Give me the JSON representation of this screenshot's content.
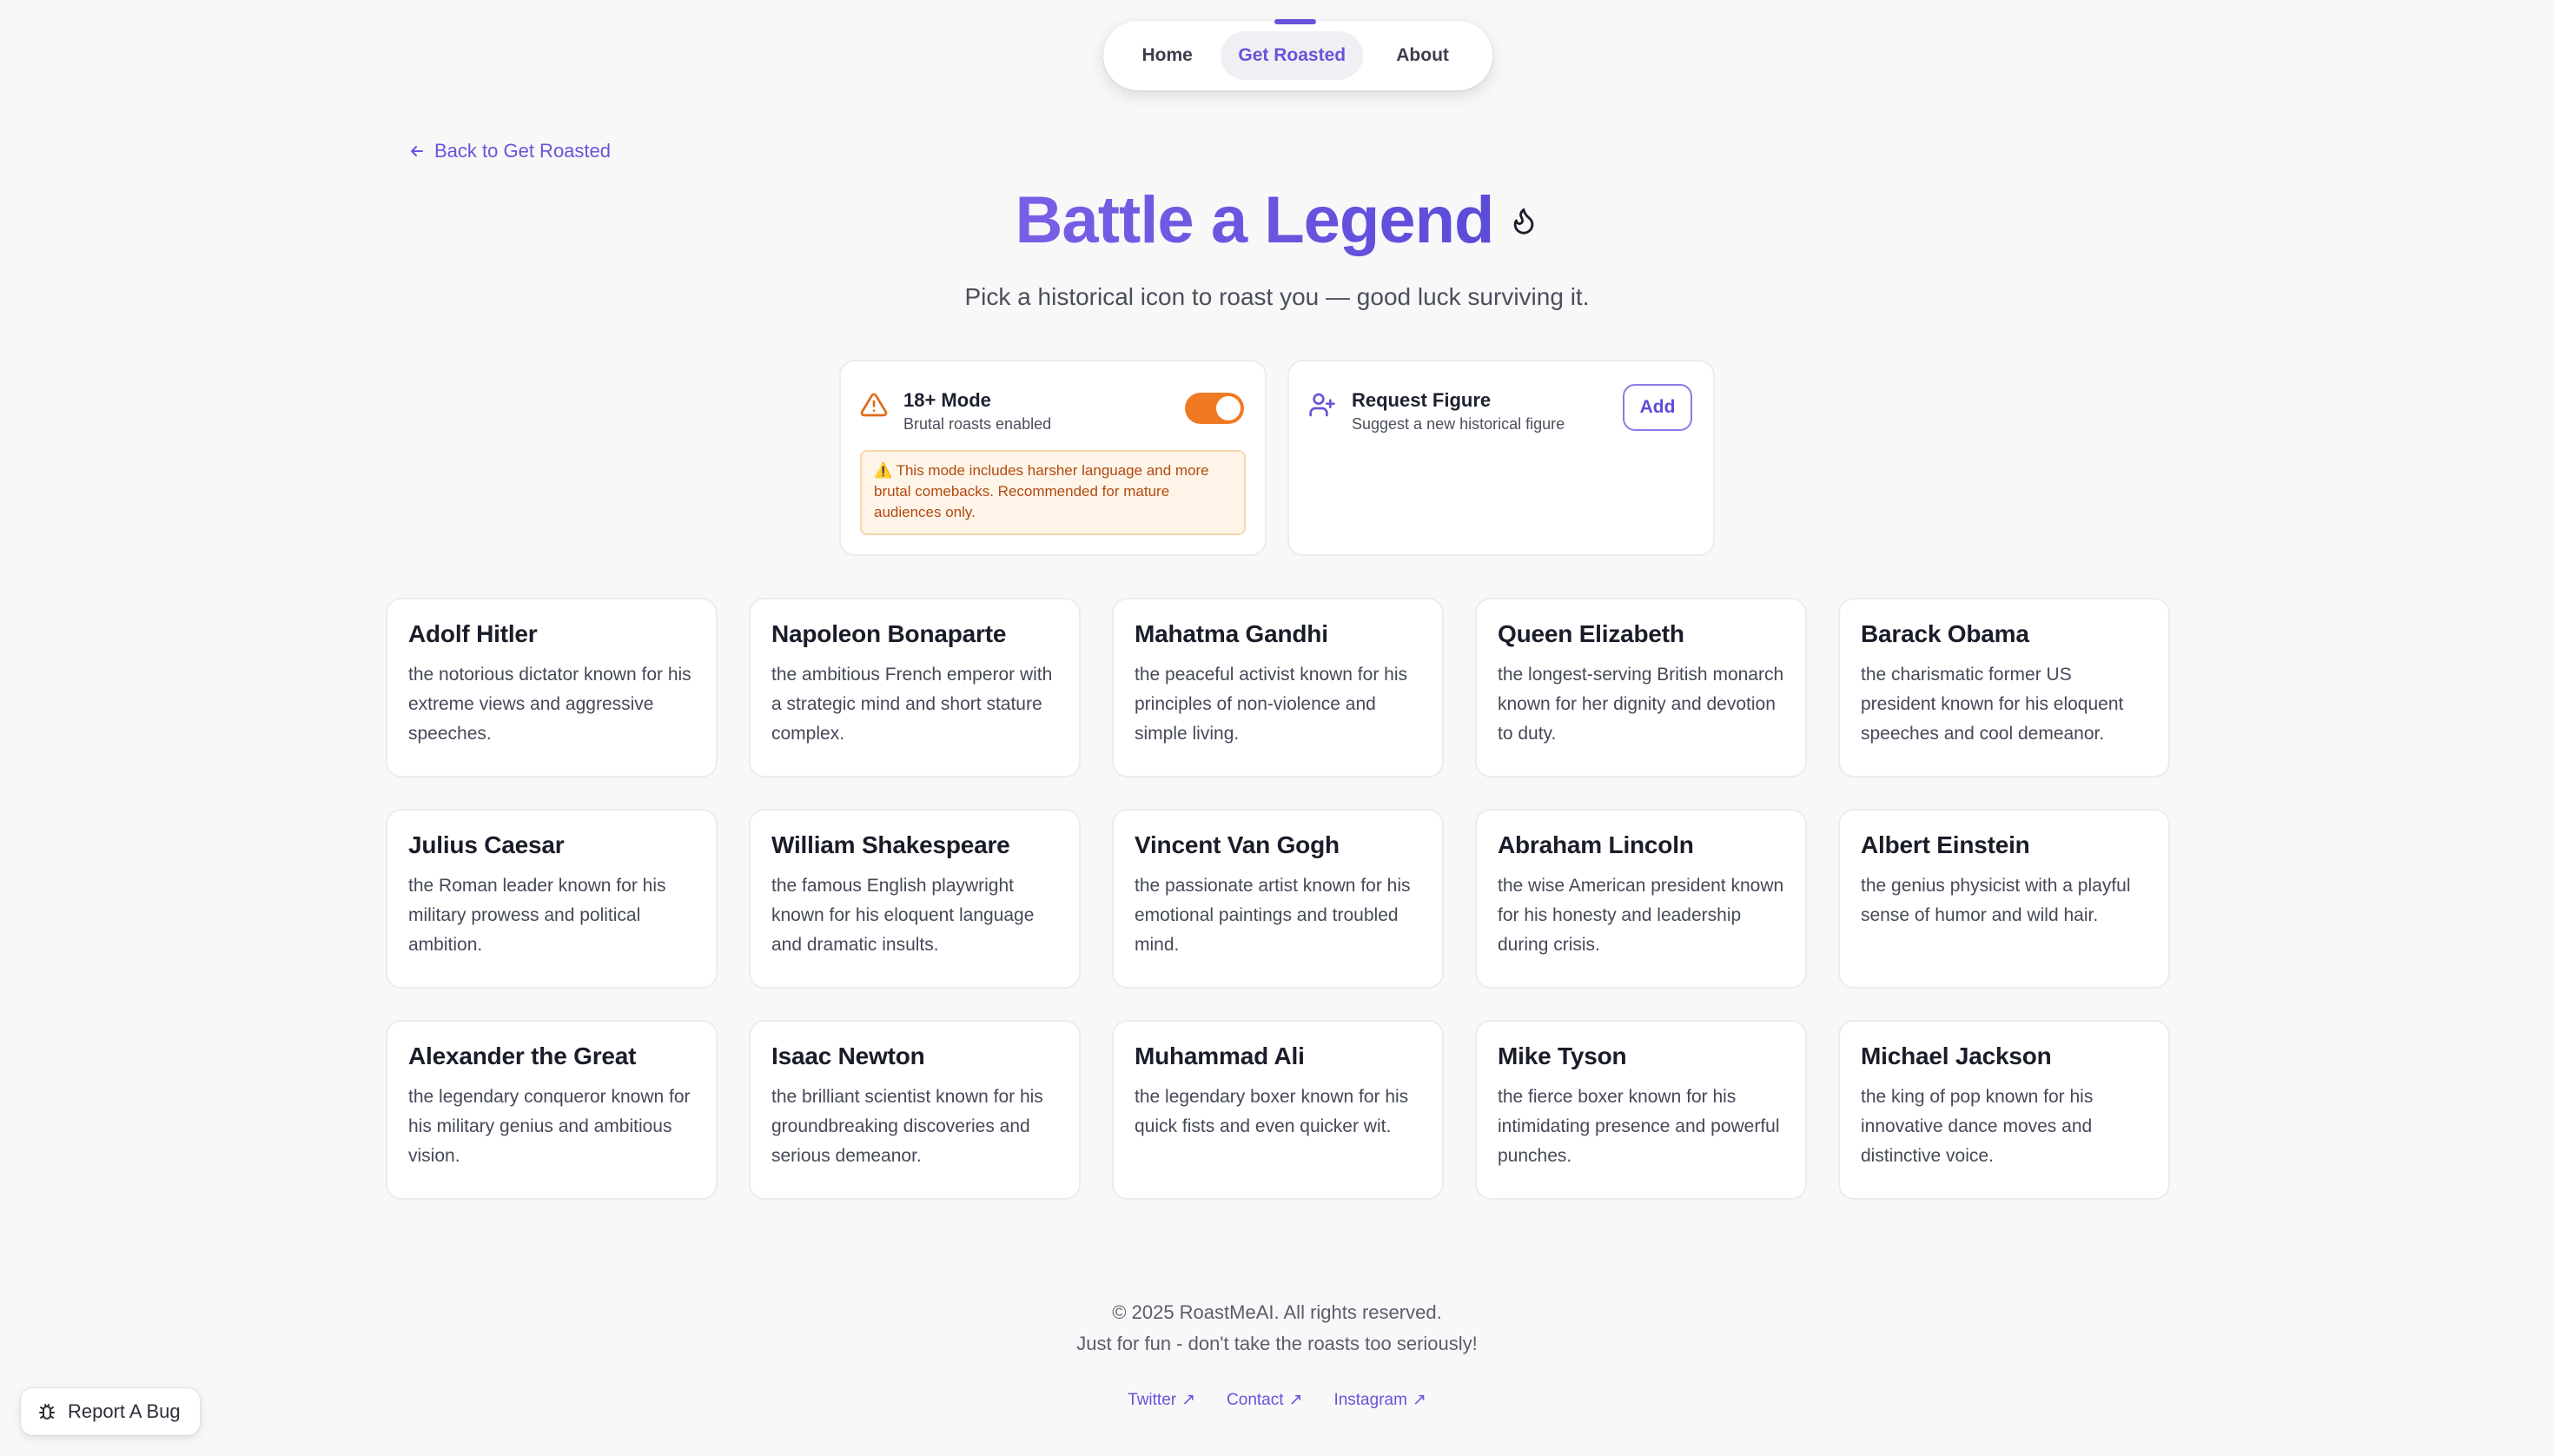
{
  "nav": {
    "items": [
      {
        "label": "Home"
      },
      {
        "label": "Get Roasted"
      },
      {
        "label": "About"
      }
    ]
  },
  "back_link": "Back to Get Roasted",
  "header": {
    "title": "Battle a Legend",
    "subtitle": "Pick a historical icon to roast you — good luck surviving it."
  },
  "mode_card": {
    "title": "18+ Mode",
    "subtitle": "Brutal roasts enabled",
    "enabled": true,
    "warning": "⚠️ This mode includes harsher language and more brutal comebacks. Recommended for mature audiences only.",
    "accent": "#f07a24"
  },
  "request_card": {
    "title": "Request Figure",
    "subtitle": "Suggest a new historical figure",
    "button_label": "Add"
  },
  "figures": [
    {
      "name": "Adolf Hitler",
      "desc": "the notorious dictator known for his extreme views and aggressive speeches."
    },
    {
      "name": "Napoleon Bonaparte",
      "desc": "the ambitious French emperor with a strategic mind and short stature complex."
    },
    {
      "name": "Mahatma Gandhi",
      "desc": "the peaceful activist known for his principles of non-violence and simple living."
    },
    {
      "name": "Queen Elizabeth",
      "desc": "the longest-serving British monarch known for her dignity and devotion to duty."
    },
    {
      "name": "Barack Obama",
      "desc": "the charismatic former US president known for his eloquent speeches and cool demeanor."
    },
    {
      "name": "Julius Caesar",
      "desc": "the Roman leader known for his military prowess and political ambition."
    },
    {
      "name": "William Shakespeare",
      "desc": "the famous English playwright known for his eloquent language and dramatic insults."
    },
    {
      "name": "Vincent Van Gogh",
      "desc": "the passionate artist known for his emotional paintings and troubled mind."
    },
    {
      "name": "Abraham Lincoln",
      "desc": "the wise American president known for his honesty and leadership during crisis."
    },
    {
      "name": "Albert Einstein",
      "desc": "the genius physicist with a playful sense of humor and wild hair."
    },
    {
      "name": "Alexander the Great",
      "desc": "the legendary conqueror known for his military genius and ambitious vision."
    },
    {
      "name": "Isaac Newton",
      "desc": "the brilliant scientist known for his groundbreaking discoveries and serious demeanor."
    },
    {
      "name": "Muhammad Ali",
      "desc": "the legendary boxer known for his quick fists and even quicker wit."
    },
    {
      "name": "Mike Tyson",
      "desc": "the fierce boxer known for his intimidating presence and powerful punches."
    },
    {
      "name": "Michael Jackson",
      "desc": "the king of pop known for his innovative dance moves and distinctive voice."
    }
  ],
  "footer": {
    "copyright": "© 2025 RoastMeAI. All rights reserved.",
    "tagline": "Just for fun - don't take the roasts too seriously!",
    "links": [
      {
        "label": "Twitter"
      },
      {
        "label": "Contact"
      },
      {
        "label": "Instagram"
      }
    ]
  },
  "report_bug": "Report A Bug",
  "colors": {
    "brand": "#6b52d9",
    "warning_text": "#b04a10",
    "warning_bg": "#fff4e8"
  }
}
